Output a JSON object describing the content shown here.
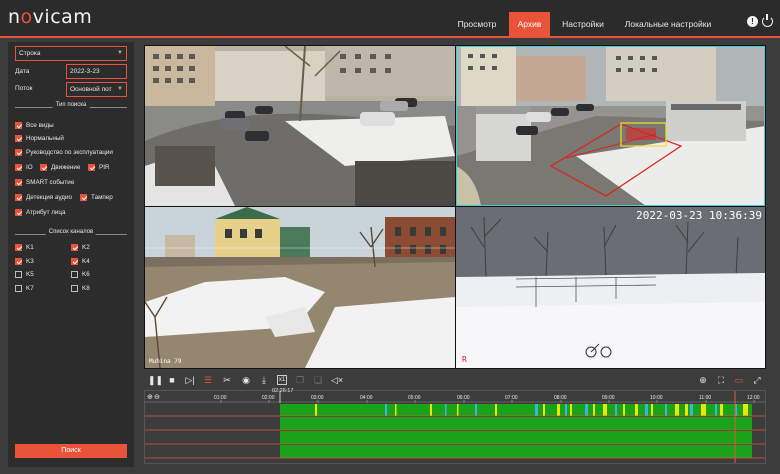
{
  "header": {
    "logo_pre": "n",
    "logo_o": "o",
    "logo_post": "vicam",
    "nav": [
      {
        "label": "Просмотр",
        "active": false
      },
      {
        "label": "Архив",
        "active": true
      },
      {
        "label": "Настройки",
        "active": false
      },
      {
        "label": "Локальные настройки",
        "active": false
      }
    ],
    "alert_glyph": "!"
  },
  "sidebar": {
    "mode_select": "Строка",
    "date_label": "Дата",
    "date_value": "2022-3-23",
    "stream_label": "Поток",
    "stream_value": "Основной пот",
    "search_type_title": "Тип поиска",
    "search_types": [
      {
        "label": "Все виды",
        "checked": true
      },
      {
        "label": "Нормальный",
        "checked": true
      },
      {
        "label": "Руководство по эксплуатации",
        "checked": true
      },
      {
        "label": "IO",
        "checked": true
      },
      {
        "label": "Движение",
        "checked": true
      },
      {
        "label": "PIR",
        "checked": true
      },
      {
        "label": "SMART событие",
        "checked": true
      },
      {
        "label": "Детекция аудио",
        "checked": true
      },
      {
        "label": "Тампер",
        "checked": true
      },
      {
        "label": "Атрибут лица",
        "checked": true
      }
    ],
    "channel_list_title": "Список каналов",
    "channels": [
      {
        "label": "K1",
        "checked": true
      },
      {
        "label": "K2",
        "checked": true
      },
      {
        "label": "K3",
        "checked": true
      },
      {
        "label": "K4",
        "checked": true
      },
      {
        "label": "K5",
        "checked": false
      },
      {
        "label": "K6",
        "checked": false
      },
      {
        "label": "K7",
        "checked": false
      },
      {
        "label": "K8",
        "checked": false
      }
    ],
    "search_button": "Поиск"
  },
  "cameras": {
    "cam3_osd": "Muhina 79",
    "cam4_osd": "2022-03-23  10:36:39",
    "cam4_flag": "R"
  },
  "toolbar": {
    "icons": [
      "pause-icon",
      "stop-icon",
      "step-forward-icon",
      "adjust-icon",
      "clip-icon",
      "snapshot-icon",
      "download-icon",
      "x1-icon",
      "copy-icon",
      "paste-icon",
      "mute-icon",
      "zoom-in-icon",
      "fit-icon",
      "layout-icon",
      "fullscreen-icon"
    ]
  },
  "timeline": {
    "current_time": "02:26:17",
    "ticks": [
      "01:00",
      "02:00",
      "03:00",
      "04:00",
      "05:00",
      "06:00",
      "07:00",
      "08:00",
      "09:00",
      "10:00",
      "11:00",
      "12:00"
    ],
    "colors": {
      "normal": "#1aa31a",
      "motion": "#e8e800",
      "io": "#39b5e0",
      "accent": "#e8533a"
    }
  }
}
